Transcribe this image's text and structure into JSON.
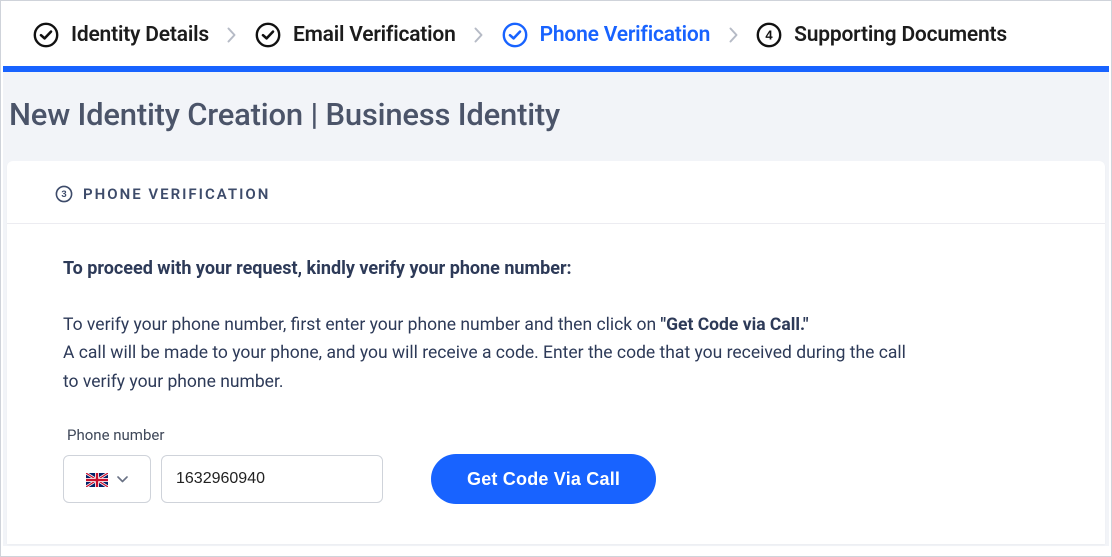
{
  "stepper": {
    "steps": [
      {
        "label": "Identity Details",
        "state": "done"
      },
      {
        "label": "Email Verification",
        "state": "done"
      },
      {
        "label": "Phone Verification",
        "state": "active"
      },
      {
        "label": "Supporting Documents",
        "state": "pending",
        "number": "4"
      }
    ]
  },
  "page_title": "New Identity Creation | Business Identity",
  "card": {
    "step_number": "3",
    "step_title": "PHONE VERIFICATION",
    "lead": "To proceed with your request, kindly verify your phone number:",
    "desc_1": "To verify your phone number, first enter your phone number and then click on ",
    "desc_bold": "\"Get Code via Call.\"",
    "desc_2": "A call will be made to your phone, and you will receive a code. Enter the code that you received during the call to verify your phone number.",
    "field_label": "Phone number",
    "country_code": "GB",
    "phone_value": "1632960940",
    "button_label": "Get Code Via Call"
  }
}
